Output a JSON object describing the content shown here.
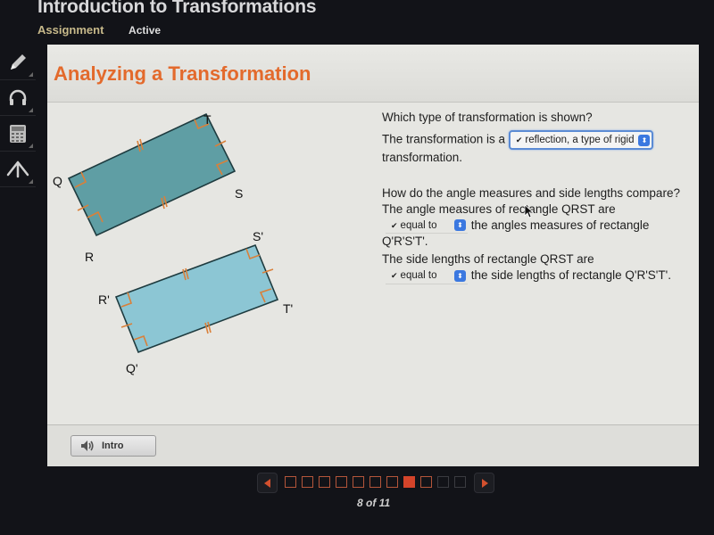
{
  "app": {
    "title": "Introduction to Transformations",
    "subnav": {
      "assignment": "Assignment",
      "status": "Active"
    }
  },
  "toolbar": {
    "items": [
      {
        "name": "pencil-icon",
        "label": "Pencil"
      },
      {
        "name": "headphones-icon",
        "label": "Audio"
      },
      {
        "name": "calculator-icon",
        "label": "Calculator"
      },
      {
        "name": "compass-icon",
        "label": "Geometry"
      }
    ]
  },
  "card": {
    "title": "Analyzing a Transformation",
    "diagram": {
      "original": {
        "labels": {
          "Q": "Q",
          "R": "R",
          "S": "S",
          "T": "T"
        }
      },
      "image": {
        "labels": {
          "Q": "Q'",
          "R": "R'",
          "S": "S'",
          "T": "T'"
        }
      },
      "colors": {
        "original_fill": "#5f9ea4",
        "image_fill": "#8cc6d4",
        "stroke": "#1e3b3f",
        "marks": "#d9803a"
      }
    },
    "questions": {
      "q1": {
        "prompt": "Which type of transformation is shown?",
        "lead": "The transformation is a",
        "selected": "reflection, a type of rigid",
        "trail": "transformation."
      },
      "q2": {
        "prompt": "How do the angle measures and side lengths compare?",
        "angle_lead": "The angle measures of rectangle QRST are",
        "angle_selected": "equal to",
        "angle_trail": "the angles measures of rectangle Q'R'S'T'.",
        "side_lead": "The side lengths of rectangle QRST are",
        "side_selected": "equal to",
        "side_trail": "the side lengths of rectangle Q'R'S'T'."
      }
    },
    "footer": {
      "intro_label": "Intro"
    }
  },
  "pager": {
    "current": 8,
    "total": 11,
    "label": "8 of 11",
    "accent": "#d4442a"
  }
}
